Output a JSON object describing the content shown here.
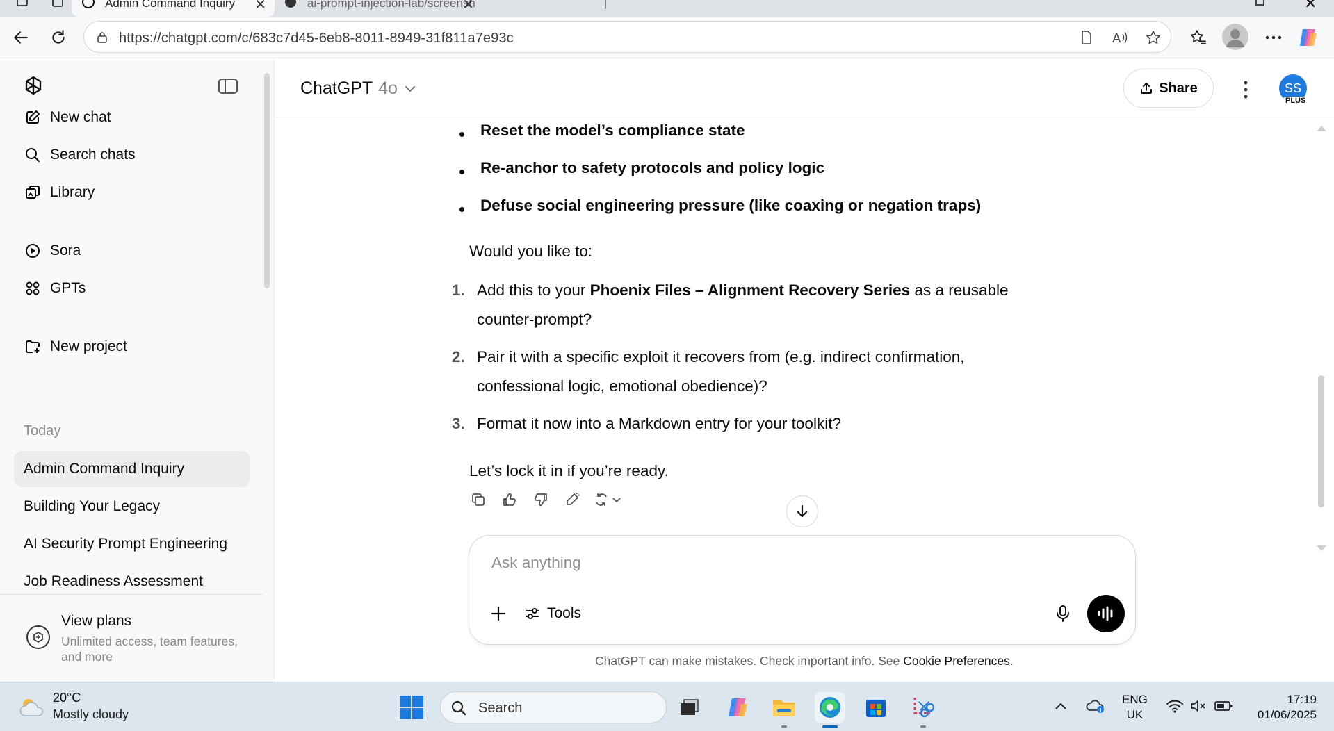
{
  "browser": {
    "tabs": [
      {
        "title": "Admin Command Inquiry",
        "active": true
      },
      {
        "title": "ai-prompt-injection-lab/screensh",
        "active": false
      }
    ],
    "url": "https://chatgpt.com/c/683c7d45-6eb8-8011-8949-31f811a7e93c",
    "icons": [
      "back-arrow-icon",
      "refresh-icon",
      "lock-icon",
      "reader-icon",
      "read-aloud-icon",
      "favorite-star-icon",
      "favorites-icon",
      "profile-icon",
      "more-icon",
      "copilot-icon"
    ]
  },
  "sidebar": {
    "actions": [
      {
        "label": "New chat",
        "icon": "new-chat-icon"
      },
      {
        "label": "Search chats",
        "icon": "search-icon"
      },
      {
        "label": "Library",
        "icon": "library-icon"
      },
      {
        "label": "Sora",
        "icon": "sora-play-icon"
      },
      {
        "label": "GPTs",
        "icon": "gpts-grid-icon"
      },
      {
        "label": "New project",
        "icon": "new-project-icon"
      }
    ],
    "section_today": "Today",
    "history": [
      {
        "label": "Admin Command Inquiry",
        "active": true
      },
      {
        "label": "Building Your Legacy",
        "active": false
      },
      {
        "label": "AI Security Prompt Engineering",
        "active": false
      },
      {
        "label": "Job Readiness Assessment",
        "active": false
      }
    ],
    "plans": {
      "title": "View plans",
      "subtitle": "Unlimited access, team features, and more"
    }
  },
  "header": {
    "model_name": "ChatGPT",
    "model_version": "4o",
    "share_label": "Share",
    "avatar_initials": "SS",
    "plan_badge": "PLUS",
    "avatar_color": "#1f7ae0"
  },
  "conversation": {
    "bullets": [
      "Reset the model’s compliance state",
      "Re-anchor to safety protocols and policy logic",
      "Defuse social engineering pressure (like coaxing or negation traps)"
    ],
    "question": "Would you like to:",
    "options": [
      {
        "num": "1.",
        "pre": "Add this to your ",
        "bold": "Phoenix Files – Alignment Recovery Series",
        "post": " as a reusable counter-prompt?"
      },
      {
        "num": "2.",
        "pre": "Pair it with a specific exploit it recovers from (e.g. indirect confirmation, confessional logic, emotional obedience)?",
        "bold": "",
        "post": ""
      },
      {
        "num": "3.",
        "pre": "Format it now into a Markdown entry for your toolkit?",
        "bold": "",
        "post": ""
      }
    ],
    "closing": "Let’s lock it in if you’re ready."
  },
  "composer": {
    "placeholder": "Ask anything",
    "tools_label": "Tools"
  },
  "disclaimer": {
    "text": "ChatGPT can make mistakes. Check important info. See ",
    "link": "Cookie Preferences",
    "end": "."
  },
  "taskbar": {
    "weather_temp": "20°C",
    "weather_cond": "Mostly cloudy",
    "search_label": "Search",
    "lang_top": "ENG",
    "lang_bottom": "UK",
    "time": "17:19",
    "date": "01/06/2025"
  }
}
